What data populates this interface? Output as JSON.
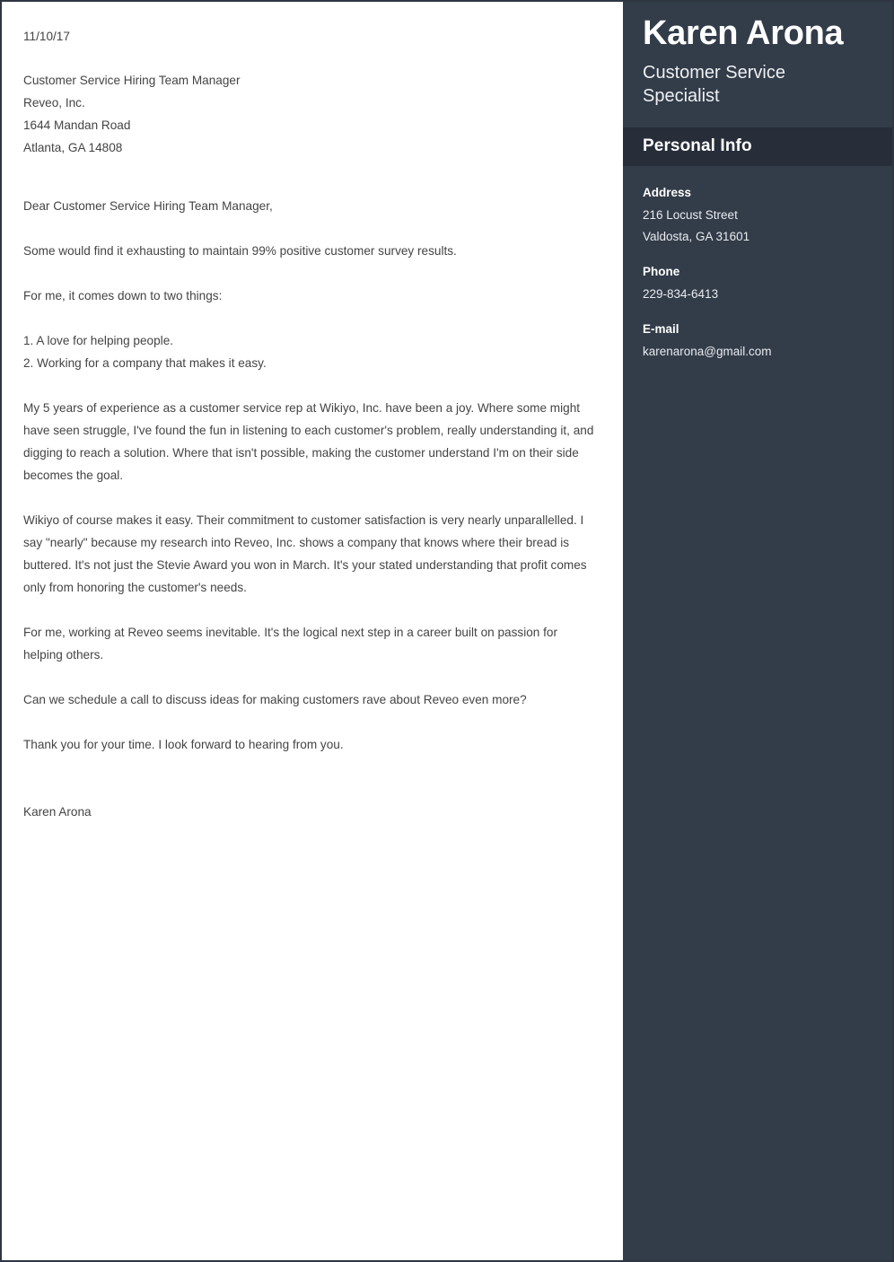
{
  "letter": {
    "date": "11/10/17",
    "recipient": [
      "Customer Service Hiring Team Manager",
      "Reveo, Inc.",
      "1644 Mandan Road",
      "Atlanta, GA 14808"
    ],
    "salutation": "Dear Customer Service Hiring Team Manager,",
    "para_1": "Some would find it exhausting to maintain 99% positive customer survey results.",
    "para_2": "For me, it comes down to two things:",
    "list": [
      "1. A love for helping people.",
      "2. Working for a company that makes it easy."
    ],
    "para_3": "My 5 years of experience as a customer service rep at Wikiyo, Inc. have been a joy. Where some might have seen struggle, I've found the fun in listening to each customer's problem, really understanding it, and digging to reach a solution. Where that isn't possible, making the customer understand I'm on their side becomes the goal.",
    "para_4": "Wikiyo of course makes it easy. Their commitment to customer satisfaction is very nearly unparallelled. I say \"nearly\" because my research into Reveo, Inc. shows a company that knows where their bread is buttered. It's not just the Stevie Award you won in March. It's your stated understanding that profit comes only from honoring the customer's needs.",
    "para_5": "For me, working at Reveo seems inevitable. It's the logical next step in a career built on passion for helping others.",
    "para_6": "Can we schedule a call to discuss ideas for making customers rave about Reveo even more?",
    "para_7": "Thank you for your time. I look forward to hearing from you.",
    "signature": "Karen Arona"
  },
  "sidebar": {
    "name": "Karen Arona",
    "title": "Customer Service Specialist",
    "section_title": "Personal Info",
    "info": [
      {
        "label": "Address",
        "line_1": "216 Locust Street",
        "line_2": "Valdosta, GA 31601"
      },
      {
        "label": "Phone",
        "line_1": "229-834-6413"
      },
      {
        "label": "E-mail",
        "line_1": "karenarona@gmail.com"
      }
    ]
  },
  "colors": {
    "sidebar_background": "#333c49",
    "section_bar_background": "#272e39",
    "page_border": "#2f3642",
    "body_text": "#444444"
  }
}
